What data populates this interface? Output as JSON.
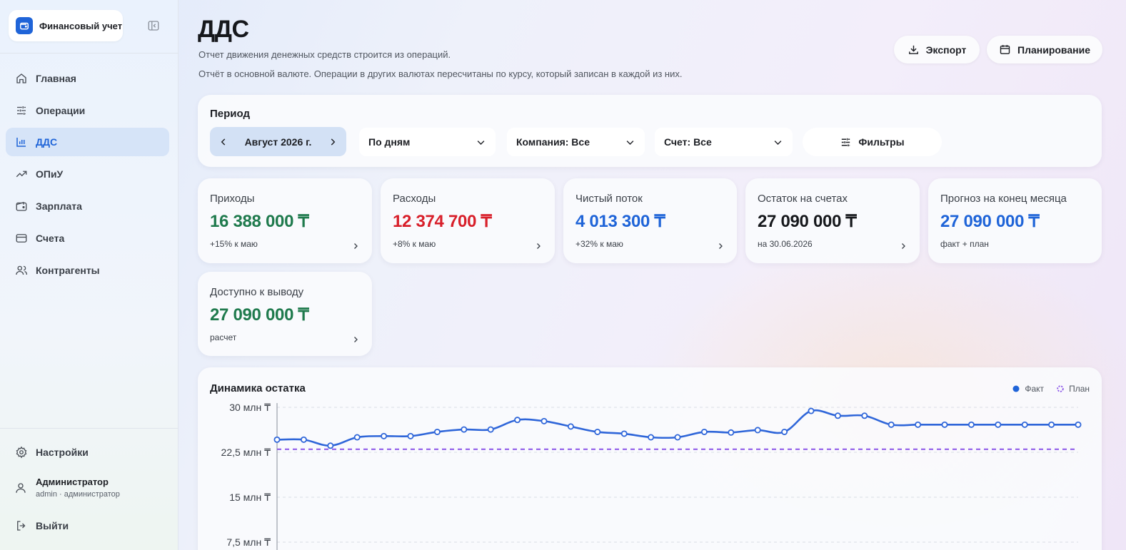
{
  "sidebar": {
    "brand_name": "Финансовый учет",
    "nav": [
      {
        "label": "Главная",
        "icon": "home-icon"
      },
      {
        "label": "Операции",
        "icon": "sliders-icon"
      },
      {
        "label": "ДДС",
        "icon": "bar-chart-icon",
        "active": true
      },
      {
        "label": "ОПиУ",
        "icon": "trend-up-icon"
      },
      {
        "label": "Зарплата",
        "icon": "wallet-icon"
      },
      {
        "label": "Счета",
        "icon": "credit-card-icon"
      },
      {
        "label": "Контрагенты",
        "icon": "users-icon"
      }
    ],
    "settings_label": "Настройки",
    "user_name": "Администратор",
    "user_sub": "admin · администратор",
    "logout_label": "Выйти"
  },
  "header": {
    "title": "ДДС",
    "subtitle_1": "Отчет движения денежных средств строится из операций.",
    "subtitle_2": "Отчёт в основной валюте. Операции в других валютах пересчитаны по курсу, который записан в каждой из них.",
    "export_label": "Экспорт",
    "planning_label": "Планирование"
  },
  "period": {
    "label": "Период",
    "month": "Август 2026 г.",
    "granularity": "По дням",
    "company": "Компания: Все",
    "account": "Счет: Все",
    "filters_label": "Фильтры"
  },
  "kpis": [
    {
      "label": "Приходы",
      "value": "16 388 000 ₸",
      "sub": "+15% к маю",
      "color": "green"
    },
    {
      "label": "Расходы",
      "value": "12 374 700 ₸",
      "sub": "+8% к маю",
      "color": "red"
    },
    {
      "label": "Чистый поток",
      "value": "4 013 300 ₸",
      "sub": "+32% к маю",
      "color": "blue"
    },
    {
      "label": "Остаток на счетах",
      "value": "27 090 000 ₸",
      "sub": "на 30.06.2026",
      "color": "dark"
    },
    {
      "label": "Прогноз на конец месяца",
      "value": "27 090 000 ₸",
      "sub": "факт + план",
      "color": "blue",
      "no_arrow": true
    },
    {
      "label": "Доступно к выводу",
      "value": "27 090 000 ₸",
      "sub": "расчет",
      "color": "green"
    }
  ],
  "colors": {
    "accent": "#1f64d8",
    "fact_line": "#2f66d9",
    "plan_line": "#8b55e8",
    "positive": "#1f7a4d",
    "negative": "#d81f2a"
  },
  "chart_data": {
    "type": "line",
    "title": "Динамика остатка",
    "legend": [
      "Факт",
      "План"
    ],
    "legend_position": "top-right",
    "y_ticks": [
      "30 млн ₸",
      "22,5 млн ₸",
      "15 млн ₸",
      "7,5 млн ₸"
    ],
    "y_tick_values": [
      30,
      22.5,
      15,
      7.5
    ],
    "ylim": [
      7.5,
      30
    ],
    "y_unit": "млн ₸",
    "grid": true,
    "series": [
      {
        "name": "Факт",
        "values": [
          24.6,
          24.6,
          23.6,
          25.0,
          25.2,
          25.2,
          25.9,
          26.3,
          26.3,
          27.9,
          27.7,
          26.8,
          25.9,
          25.6,
          25.0,
          25.0,
          25.9,
          25.8,
          26.2,
          25.9,
          29.4,
          28.6,
          28.6,
          27.1,
          27.1,
          27.1,
          27.1,
          27.1,
          27.1,
          27.1,
          27.1
        ]
      },
      {
        "name": "План",
        "values": [
          23.0,
          23.0,
          23.0,
          23.0,
          23.0,
          23.0,
          23.0,
          23.0,
          23.0,
          23.0,
          23.0,
          23.0,
          23.0,
          23.0,
          23.0,
          23.0,
          23.0,
          23.0,
          23.0,
          23.0,
          23.0,
          23.0,
          23.0,
          23.0,
          23.0,
          23.0,
          23.0,
          23.0,
          23.0,
          23.0,
          23.0
        ]
      }
    ]
  }
}
